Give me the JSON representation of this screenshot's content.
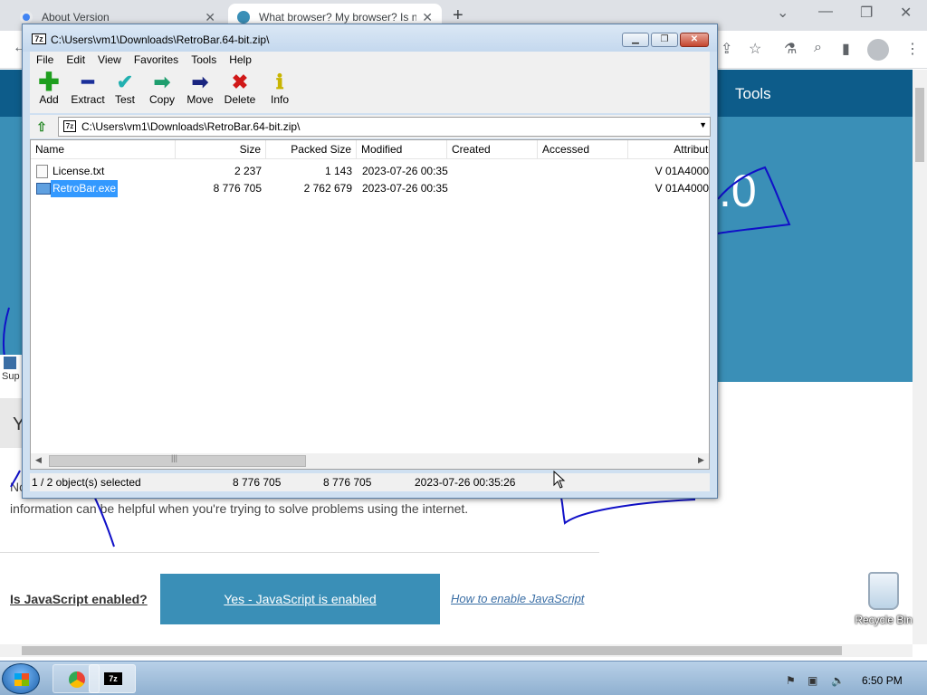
{
  "browser": {
    "tabs": [
      {
        "title": "About Version",
        "close": "✕"
      },
      {
        "title": "What browser? My browser? Is n",
        "close": "✕"
      }
    ],
    "new_tab": "+",
    "site": {
      "nav_tools": "Tools",
      "big_version": ".0",
      "letter_y": "Y",
      "text_no": "No",
      "info_text": "information can be helpful when you're trying to solve problems using the internet.",
      "js_label": "Is JavaScript enabled?",
      "js_status": "Yes - JavaScript is enabled",
      "js_how": "How to enable JavaScript",
      "shortcut_label": "Sup"
    }
  },
  "zip": {
    "title": "C:\\Users\\vm1\\Downloads\\RetroBar.64-bit.zip\\",
    "menu": [
      "File",
      "Edit",
      "View",
      "Favorites",
      "Tools",
      "Help"
    ],
    "toolbar": [
      {
        "label": "Add",
        "icon": "add-icon",
        "color": "#1e9e1e"
      },
      {
        "label": "Extract",
        "icon": "extract-icon",
        "color": "#1a2f9a"
      },
      {
        "label": "Test",
        "icon": "test-icon",
        "color": "#22b0b0"
      },
      {
        "label": "Copy",
        "icon": "copy-icon",
        "color": "#1e9e6e"
      },
      {
        "label": "Move",
        "icon": "move-icon",
        "color": "#1a2580"
      },
      {
        "label": "Delete",
        "icon": "delete-icon",
        "color": "#d01818"
      },
      {
        "label": "Info",
        "icon": "info-icon",
        "color": "#c8b400"
      }
    ],
    "address": "C:\\Users\\vm1\\Downloads\\RetroBar.64-bit.zip\\",
    "columns": [
      "Name",
      "Size",
      "Packed Size",
      "Modified",
      "Created",
      "Accessed",
      "Attribute"
    ],
    "files": [
      {
        "name": "License.txt",
        "size": "2 237",
        "packed": "1 143",
        "modified": "2023-07-26 00:35",
        "created": "",
        "accessed": "",
        "attr": "V 01A4000",
        "selected": false
      },
      {
        "name": "RetroBar.exe",
        "size": "8 776 705",
        "packed": "2 762 679",
        "modified": "2023-07-26 00:35",
        "created": "",
        "accessed": "",
        "attr": "V 01A4000",
        "selected": true
      }
    ],
    "status": {
      "selection": "1 / 2 object(s) selected",
      "size": "8 776 705",
      "packed": "8 776 705",
      "modified": "2023-07-26 00:35:26"
    }
  },
  "desktop": {
    "recycle_bin": "Recycle Bin"
  },
  "taskbar": {
    "clock": "6:50 PM",
    "zip_label": "7z"
  },
  "colors": {
    "accent_blue": "#3a8fb7",
    "dark_blue": "#0d5c8a",
    "selection": "#3399ff",
    "scribble": "#1010c8"
  }
}
